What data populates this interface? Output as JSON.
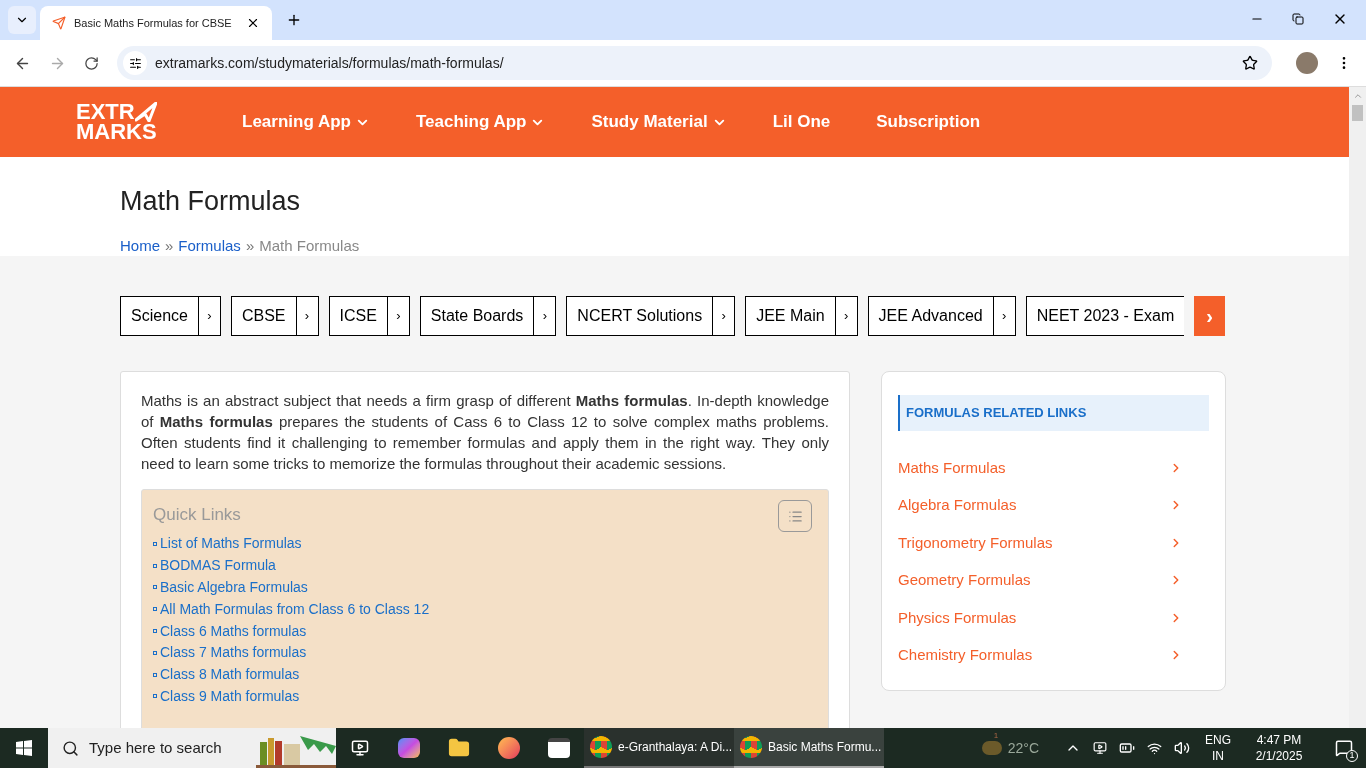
{
  "browser": {
    "tab_title": "Basic Maths Formulas for CBSE",
    "url": "extramarks.com/studymaterials/formulas/math-formulas/"
  },
  "site_nav": {
    "logo_lines": [
      "EXTR",
      "MARKS"
    ],
    "items": [
      {
        "label": "Learning App",
        "dropdown": true
      },
      {
        "label": "Teaching App",
        "dropdown": true
      },
      {
        "label": "Study Material",
        "dropdown": true
      },
      {
        "label": "Lil One",
        "dropdown": false
      },
      {
        "label": "Subscription",
        "dropdown": false
      }
    ]
  },
  "page_title": "Math Formulas",
  "breadcrumb": {
    "separator": "»",
    "items": [
      {
        "label": "Home",
        "kind": "link"
      },
      {
        "label": "Formulas",
        "kind": "link"
      },
      {
        "label": "Math Formulas",
        "kind": "current"
      }
    ]
  },
  "categories": {
    "chevron": "›",
    "next": "›",
    "items": [
      "Science",
      "CBSE",
      "ICSE",
      "State Boards",
      "NCERT Solutions",
      "JEE Main",
      "JEE Advanced",
      "NEET 2023 - Exam"
    ]
  },
  "intro": "Maths is an abstract subject that needs a firm grasp of different **Maths formulas**. In-depth knowledge of **Maths formulas** prepares the students of Cass 6 to Class 12 to solve complex maths problems. Often students find it challenging to remember formulas and apply them in the right way. They only need to learn some tricks to memorize the formulas throughout their academic sessions.",
  "quick_links": {
    "title": "Quick Links",
    "links": [
      "List of Maths Formulas",
      "BODMAS Formula",
      "Basic Algebra Formulas",
      "All Math Formulas from Class 6 to Class 12",
      "Class 6 Maths formulas",
      "Class 7 Maths formulas",
      "Class 8 Math formulas",
      "Class 9 Math formulas"
    ]
  },
  "sidebar": {
    "heading": "FORMULAS RELATED LINKS",
    "links": [
      "Maths Formulas",
      "Algebra Formulas",
      "Trigonometry Formulas",
      "Geometry Formulas",
      "Physics Formulas",
      "Chemistry Formulas"
    ]
  },
  "taskbar": {
    "search_placeholder": "Type here to search",
    "windows": [
      {
        "label": "e-Granthalaya: A Di...",
        "selected": false
      },
      {
        "label": "Basic Maths Formu...",
        "selected": true
      }
    ],
    "temperature": "22°C",
    "weather_badge": "1",
    "language": "ENG",
    "region": "IN",
    "time": "4:47 PM",
    "date": "2/1/2025",
    "notifications": "1"
  }
}
